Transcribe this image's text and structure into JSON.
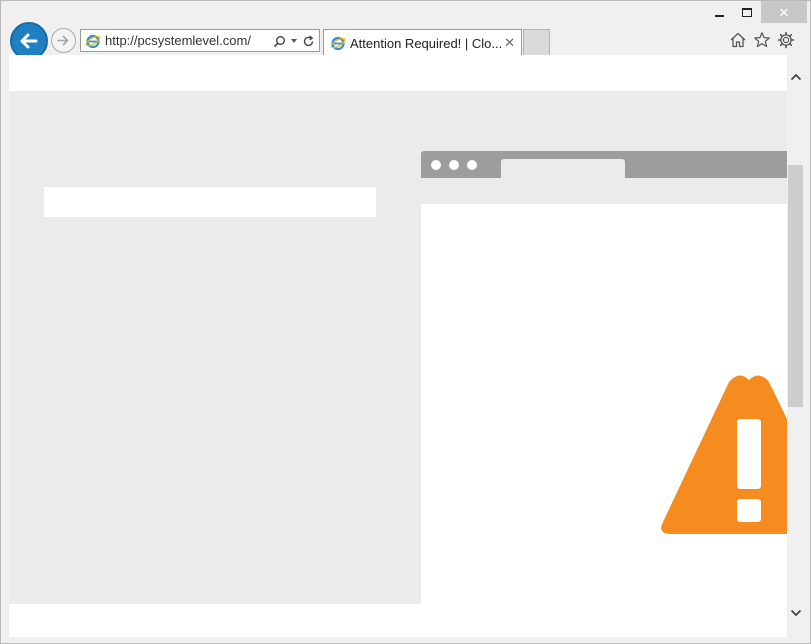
{
  "window": {
    "minimize_label": "–",
    "maximize_label": "□",
    "close_label": "✕"
  },
  "navigation": {
    "back_icon": "back-arrow-icon",
    "forward_icon": "forward-arrow-icon"
  },
  "address_bar": {
    "url": "http://pcsystemlevel.com/",
    "search_icon": "search-icon",
    "refresh_icon": "refresh-icon"
  },
  "tabs": [
    {
      "title": "Attention Required! | Clo...",
      "close_label": "✕"
    }
  ],
  "toolbar": {
    "home_icon": "home-icon",
    "favorites_icon": "star-icon",
    "settings_icon": "gear-icon"
  },
  "page": {
    "warning_icon": "warning-triangle-icon",
    "accent_color": "#f68b1f"
  }
}
